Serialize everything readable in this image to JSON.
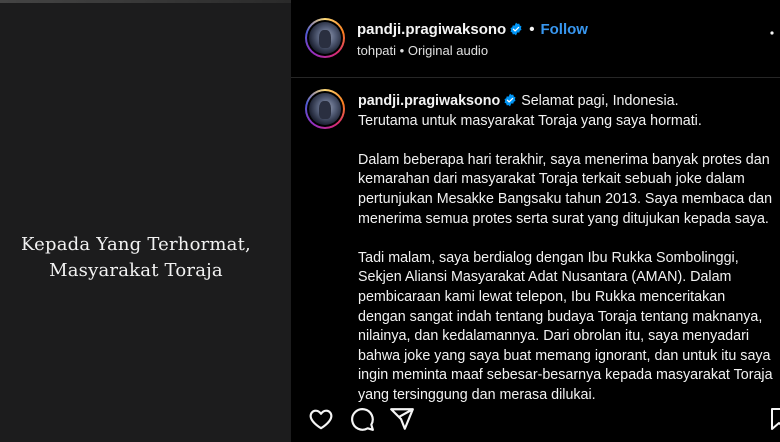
{
  "media": {
    "caption_line1": "Kepada Yang Terhormat,",
    "caption_line2": "Masyarakat Toraja"
  },
  "header": {
    "username": "pandji.pragiwaksono",
    "separator": "•",
    "follow_label": "Follow",
    "audio_source": "tohpati",
    "audio_separator": " • ",
    "audio_label": "Original audio"
  },
  "comment": {
    "author": "pandji.pragiwaksono",
    "paragraphs": [
      "Selamat pagi, Indonesia.\nTerutama untuk masyarakat Toraja yang saya hormati.",
      "Dalam beberapa hari terakhir, saya menerima banyak protes dan kemarahan dari masyarakat Toraja terkait sebuah joke dalam pertunjukan Mesakke Bangsaku tahun 2013. Saya membaca dan menerima semua protes serta surat yang ditujukan kepada saya.",
      "Tadi malam, saya berdialog dengan Ibu Rukka Sombolinggi, Sekjen Aliansi Masyarakat Adat Nusantara (AMAN). Dalam pembicaraan kami lewat telepon, Ibu Rukka menceritakan dengan sangat indah tentang budaya Toraja tentang maknanya, nilainya, dan kedalamannya. Dari obrolan itu, saya menyadari bahwa joke yang saya buat memang ignorant, dan untuk itu saya ingin meminta maaf sebesar-besarnya kepada masyarakat Toraja yang tersinggung dan merasa dilukai."
    ]
  },
  "colors": {
    "accent": "#3897f0",
    "verified": "#0095f6",
    "background": "#000000"
  },
  "icons": [
    "verified-badge-icon",
    "more-options-icon",
    "heart-icon",
    "comment-icon",
    "share-icon",
    "bookmark-icon"
  ]
}
